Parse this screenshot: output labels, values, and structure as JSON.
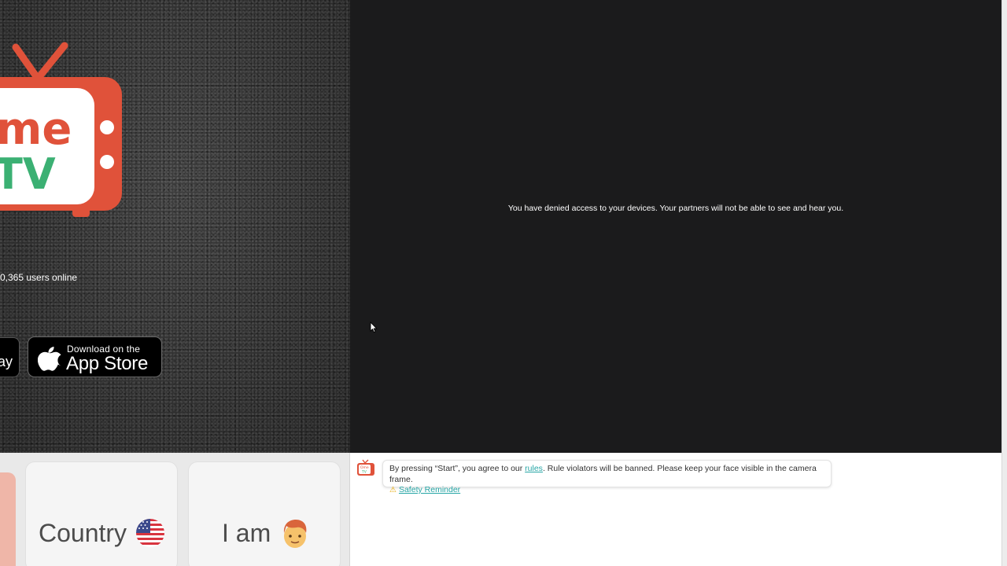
{
  "left": {
    "logo_text_top": "me",
    "logo_text_bottom": "TV",
    "online_count": "0,365 users online",
    "google_play_partial": "ay",
    "appstore": {
      "small": "Download on the",
      "big": "App Store"
    }
  },
  "video": {
    "denied_message": "You have denied access to your devices. Your partners will not be able to see and hear you."
  },
  "filters": {
    "country_label": "Country",
    "country_flag": "us-flag-icon",
    "iam_label": "I am",
    "iam_icon": "boy-face-icon"
  },
  "chat": {
    "notice_prefix": "By pressing “Start”, you agree to our ",
    "rules_link": "rules",
    "notice_suffix": ". Rule violators will be banned. Please keep your face visible in the camera frame.",
    "safety_link": "Safety Reminder",
    "warn_icon": "warning-icon"
  },
  "colors": {
    "logo_red": "#e0523a",
    "logo_green": "#3bb073",
    "link_teal": "#27a6a6",
    "video_bg": "#1b1b1c"
  }
}
